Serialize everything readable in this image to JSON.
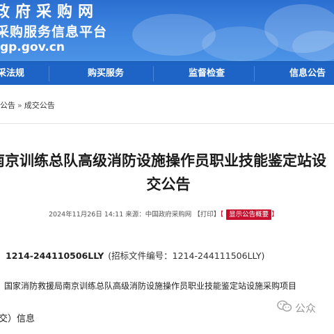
{
  "header": {
    "title_line1": "政府采购网",
    "title_line2": "采购服务信息平台",
    "url": "gp.gov.cn"
  },
  "nav": {
    "items": [
      {
        "label": "采法规"
      },
      {
        "label": "购买服务"
      },
      {
        "label": "监督检查"
      },
      {
        "label": "信息公告"
      }
    ]
  },
  "breadcrumb": {
    "items": [
      "公告",
      "成交公告"
    ],
    "separator": "»"
  },
  "article": {
    "title_line1": "南京训练总队高级消防设施操作员职业技能鉴定站设",
    "title_line2": "交公告",
    "meta": {
      "date": "2024年11月26日 14:11",
      "source": "来源：中国政府采购网",
      "print_label": "【打印】",
      "summary_label": "显示公告概要",
      "bracket_open": "【",
      "bracket_close": "】"
    },
    "project_no_code": "1214-244110506LLY",
    "project_no_rest": "(招标文件编号：1214-244111506LLY)",
    "project_name": "国家消防救援局南京训练总队高级消防设施操作员职业技能鉴定站设施采购项目",
    "deal_info": "交）信息"
  },
  "watermark": {
    "label": "公众"
  },
  "colors": {
    "header_blue": "#3f86e0",
    "nav_blue": "#1d64c6",
    "summary_red": "#c8102e"
  }
}
